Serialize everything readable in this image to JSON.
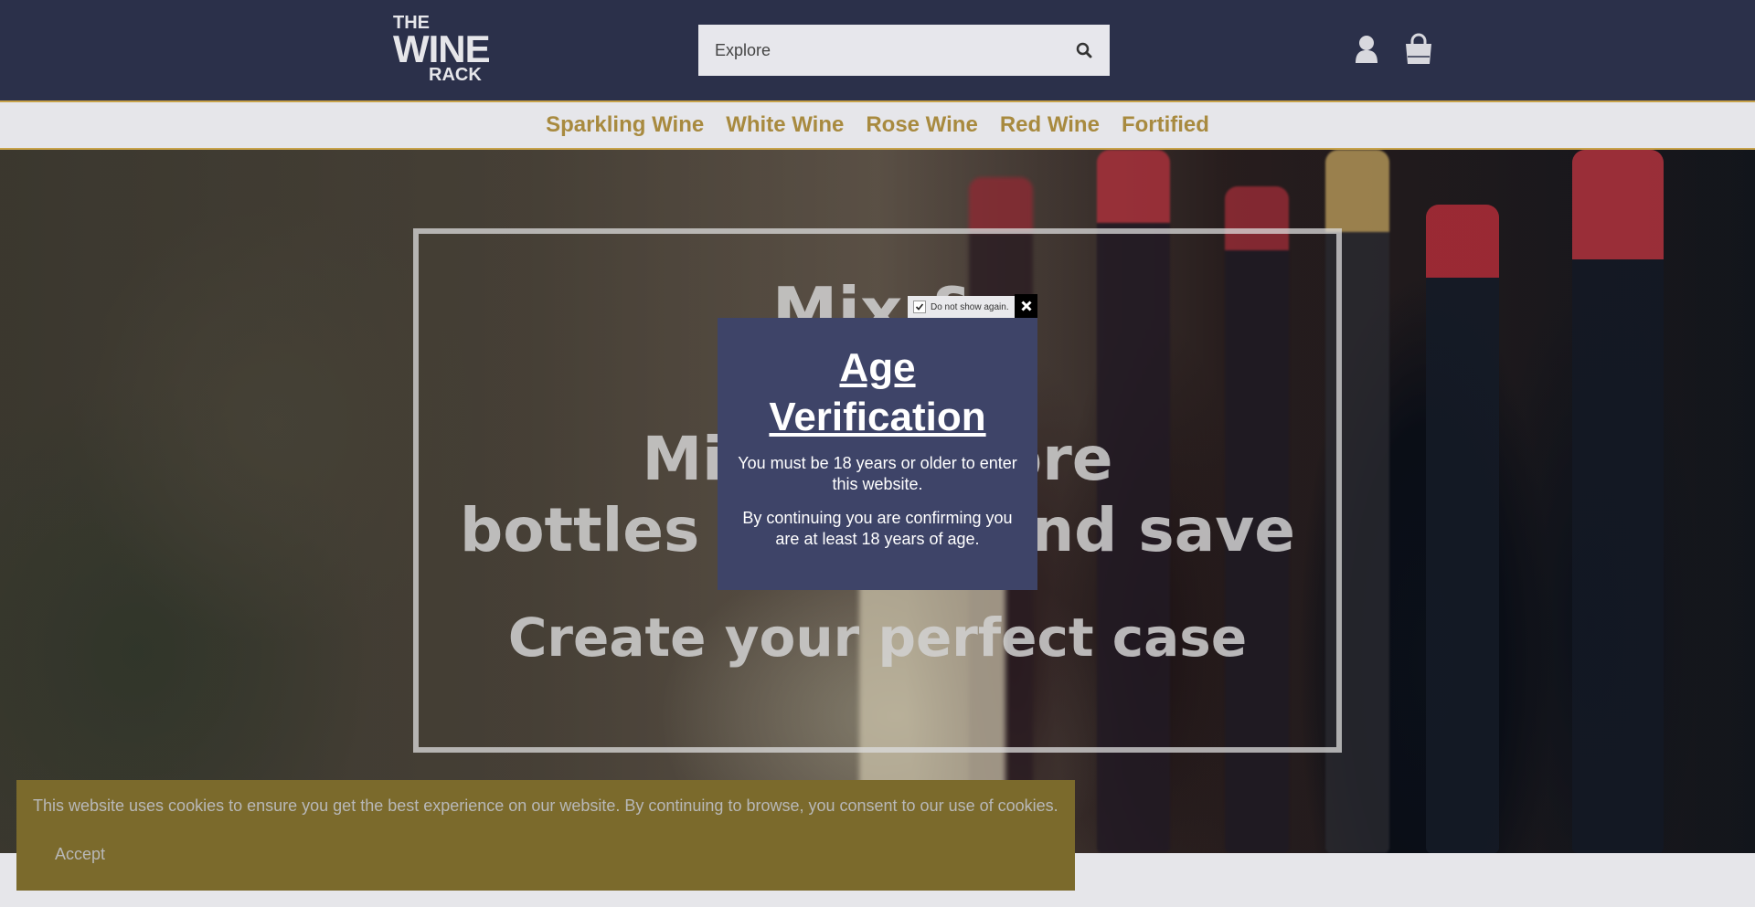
{
  "header": {
    "logo": {
      "line1": "THE",
      "line2": "WINE",
      "line3": "RACK"
    },
    "search": {
      "placeholder": "Explore"
    },
    "icons": {
      "account": "user-icon",
      "cart": "shopping-bag-icon",
      "search": "search-icon"
    }
  },
  "nav": {
    "items": [
      {
        "label": "Sparkling Wine"
      },
      {
        "label": "White Wine"
      },
      {
        "label": "Rose Wine"
      },
      {
        "label": "Red Wine"
      },
      {
        "label": "Fortified"
      }
    ]
  },
  "hero": {
    "line1": "Mix & ",
    "line2a": "Mix 6 or more",
    "line2b": "bottles of wine and save",
    "line3": "Create your perfect case"
  },
  "age_modal": {
    "do_not_show": "Do not show again.",
    "title": "Age Verification",
    "text1": "You must be 18 years or older to enter this website.",
    "text2": "By continuing you are confirming you are at least 18 years of age."
  },
  "cookie_bar": {
    "message": "This website uses cookies to ensure you get the best experience on our website. By continuing to browse, you consent to our use of cookies.",
    "accept_label": "Accept"
  },
  "colors": {
    "header_bg": "#2b304a",
    "nav_text": "#a88a3f",
    "modal_bg": "#3e4468",
    "cookie_bg": "#7b6a2c"
  }
}
